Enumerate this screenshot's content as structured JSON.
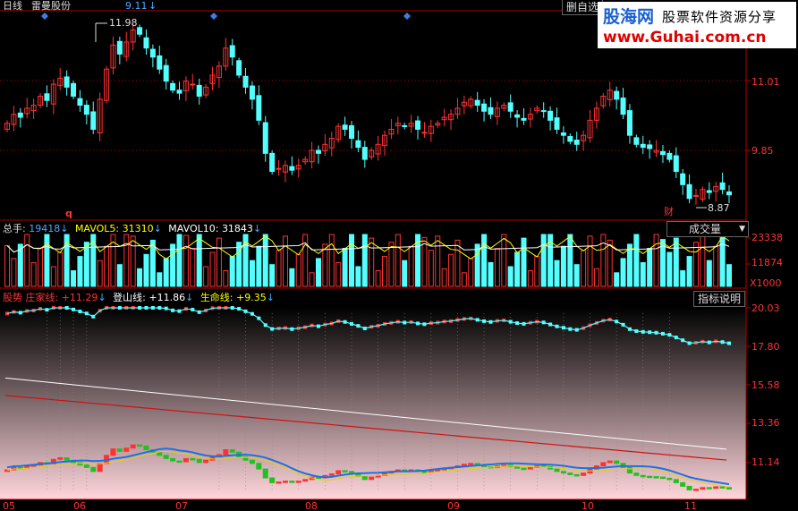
{
  "header": {
    "period": "日线",
    "stock_name": "雷曼股份",
    "price": "9.11",
    "arrow": "↓",
    "self_select_label": "删自选"
  },
  "watermark": {
    "logo": "股海网",
    "slogan": "股票软件资源分享",
    "url": "www.Guhai.com.cn"
  },
  "main_panel": {
    "y_ticks": [
      "11.01",
      "9.85"
    ],
    "high_label": "11.98",
    "low_label": "8.87",
    "q_marker": "q",
    "cai_marker": "财"
  },
  "volume_panel": {
    "total_label": "总手:",
    "total_value": "19418",
    "ma5_label": "MAVOL5:",
    "ma5_value": "31310",
    "ma10_label": "MAVOL10:",
    "ma10_value": "31843",
    "dropdown_label": "成交量",
    "y_ticks": [
      "23338",
      "11874"
    ],
    "unit": "X1000"
  },
  "indicator_panel": {
    "name": "股势",
    "zhuangjia_label": "庄家线:",
    "zhuangjia_value": "+11.29",
    "dengshan_label": "登山线:",
    "dengshan_value": "+11.86",
    "shengming_label": "生命线:",
    "shengming_value": "+9.35",
    "help_label": "指标说明",
    "y_ticks": [
      "20.03",
      "17.80",
      "15.58",
      "13.36",
      "11.14"
    ]
  },
  "x_axis": {
    "labels": [
      "05",
      "06",
      "07",
      "08",
      "09",
      "10",
      "11"
    ]
  },
  "colors": {
    "up": "#ff3232",
    "down": "#54ffff",
    "ma_white": "#ffffff",
    "ma_yellow": "#ffff00",
    "grid": "#b00000"
  },
  "chart_data": {
    "type": "candlestick",
    "price_axis_ticks": [
      11.01,
      9.85
    ],
    "price_high": 11.98,
    "price_low": 8.87,
    "volume_axis_ticks": [
      23338,
      11874
    ],
    "volume_unit": "X1000",
    "indicator_axis_ticks": [
      20.03,
      17.8,
      15.58,
      13.36,
      11.14
    ],
    "latest": {
      "close": 9.11,
      "volume": 19418,
      "mavol5": 31310,
      "mavol10": 31843,
      "zhuangjia": 11.29,
      "dengshan": 11.86,
      "shengming": 9.35
    },
    "closes": [
      10.3,
      10.45,
      10.4,
      10.55,
      10.6,
      10.75,
      10.68,
      10.95,
      11.05,
      10.9,
      10.75,
      10.6,
      10.45,
      10.2,
      10.7,
      11.2,
      11.6,
      11.45,
      11.65,
      11.85,
      11.78,
      11.55,
      11.4,
      11.2,
      11.0,
      10.85,
      10.8,
      11.0,
      10.95,
      10.75,
      10.9,
      11.1,
      11.25,
      11.55,
      11.4,
      11.1,
      10.9,
      10.7,
      10.35,
      9.8,
      9.5,
      9.55,
      9.6,
      9.52,
      9.6,
      9.7,
      9.85,
      9.8,
      9.95,
      10.05,
      10.25,
      10.2,
      10.05,
      9.9,
      9.7,
      9.85,
      9.95,
      10.1,
      10.2,
      10.3,
      10.25,
      10.3,
      10.2,
      10.15,
      10.25,
      10.3,
      10.4,
      10.45,
      10.55,
      10.65,
      10.7,
      10.6,
      10.5,
      10.45,
      10.55,
      10.6,
      10.5,
      10.4,
      10.35,
      10.45,
      10.55,
      10.5,
      10.35,
      10.2,
      10.1,
      10.0,
      9.95,
      10.1,
      10.35,
      10.55,
      10.75,
      10.85,
      10.7,
      10.45,
      10.1,
      9.95,
      9.9,
      9.88,
      9.85,
      9.78,
      9.7,
      9.5,
      9.28,
      9.05,
      9.1,
      9.2,
      9.15,
      9.25,
      9.2,
      9.11
    ]
  }
}
